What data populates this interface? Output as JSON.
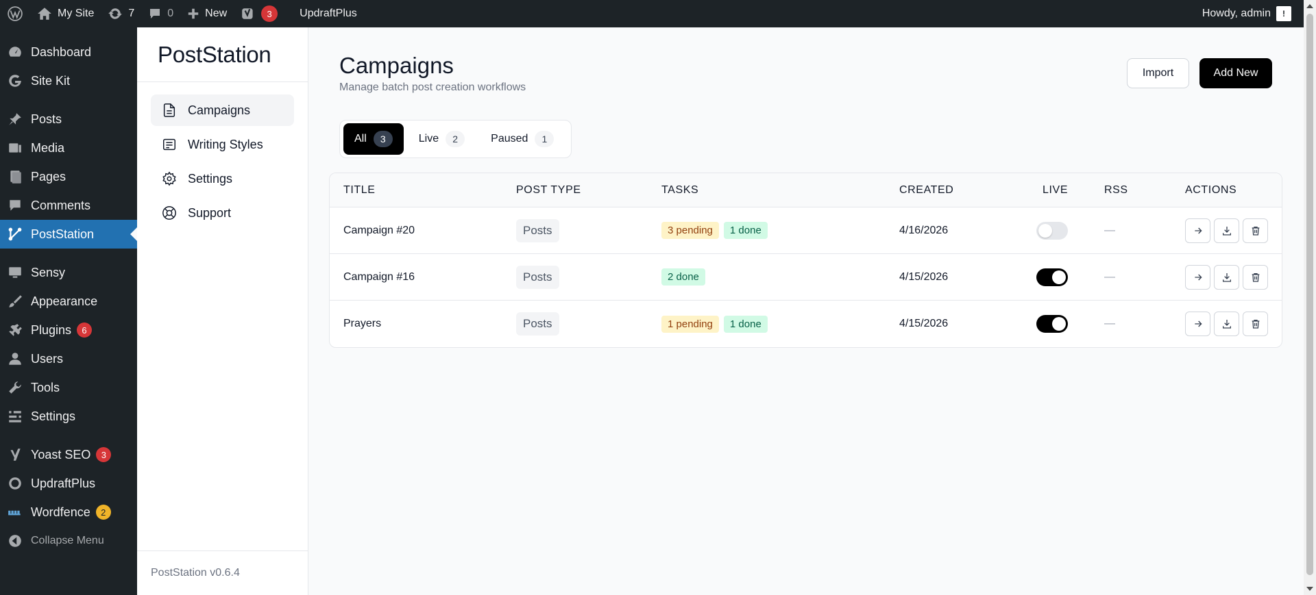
{
  "adminbar": {
    "site_name": "My Site",
    "updates_count": "7",
    "comments_count": "0",
    "new_label": "New",
    "yoast_badge": "3",
    "updraft_label": "UpdraftPlus",
    "howdy": "Howdy, admin",
    "avatar_glyph": "!"
  },
  "wpmenu": {
    "items": [
      {
        "label": "Dashboard",
        "icon": "dashboard-icon"
      },
      {
        "label": "Site Kit",
        "icon": "google-g-icon"
      },
      {
        "label": "Posts",
        "icon": "pin-icon"
      },
      {
        "label": "Media",
        "icon": "media-icon"
      },
      {
        "label": "Pages",
        "icon": "pages-icon"
      },
      {
        "label": "Comments",
        "icon": "comment-icon"
      },
      {
        "label": "PostStation",
        "icon": "network-icon"
      },
      {
        "label": "Sensy",
        "icon": "monitor-icon"
      },
      {
        "label": "Appearance",
        "icon": "brush-icon"
      },
      {
        "label": "Plugins",
        "icon": "plug-icon",
        "badge": "6"
      },
      {
        "label": "Users",
        "icon": "user-icon"
      },
      {
        "label": "Tools",
        "icon": "wrench-icon"
      },
      {
        "label": "Settings",
        "icon": "sliders-icon"
      },
      {
        "label": "Yoast SEO",
        "icon": "yoast-icon",
        "badge": "3"
      },
      {
        "label": "UpdraftPlus",
        "icon": "updraft-icon"
      },
      {
        "label": "Wordfence",
        "icon": "wordfence-icon",
        "badge": "2"
      }
    ],
    "collapse_label": "Collapse Menu"
  },
  "plugin_sidebar": {
    "brand": "PostStation",
    "nav": [
      {
        "label": "Campaigns",
        "icon": "document-icon"
      },
      {
        "label": "Writing Styles",
        "icon": "list-icon"
      },
      {
        "label": "Settings",
        "icon": "gear-icon"
      },
      {
        "label": "Support",
        "icon": "lifebuoy-icon"
      }
    ],
    "version": "PostStation v0.6.4"
  },
  "main": {
    "title": "Campaigns",
    "subtitle": "Manage batch post creation workflows",
    "import_label": "Import",
    "add_new_label": "Add New",
    "filters": [
      {
        "label": "All",
        "count": "3"
      },
      {
        "label": "Live",
        "count": "2"
      },
      {
        "label": "Paused",
        "count": "1"
      }
    ]
  },
  "table": {
    "columns": [
      "TITLE",
      "POST TYPE",
      "TASKS",
      "CREATED",
      "LIVE",
      "RSS",
      "ACTIONS"
    ],
    "rows": [
      {
        "title": "Campaign #20",
        "post_type": "Posts",
        "pending": "3 pending",
        "done": "1 done",
        "created": "4/16/2026",
        "live": false,
        "rss": "—"
      },
      {
        "title": "Campaign #16",
        "post_type": "Posts",
        "pending": "",
        "done": "2 done",
        "created": "4/15/2026",
        "live": true,
        "rss": "—"
      },
      {
        "title": "Prayers",
        "post_type": "Posts",
        "pending": "1 pending",
        "done": "1 done",
        "created": "4/15/2026",
        "live": true,
        "rss": "—"
      }
    ]
  },
  "colors": {
    "wp_dark": "#1d2327",
    "wp_blue": "#2271b1",
    "badge_red": "#d63638",
    "badge_orange": "#f0b429",
    "pending_bg": "#fef3c7",
    "done_bg": "#d1fae5"
  }
}
